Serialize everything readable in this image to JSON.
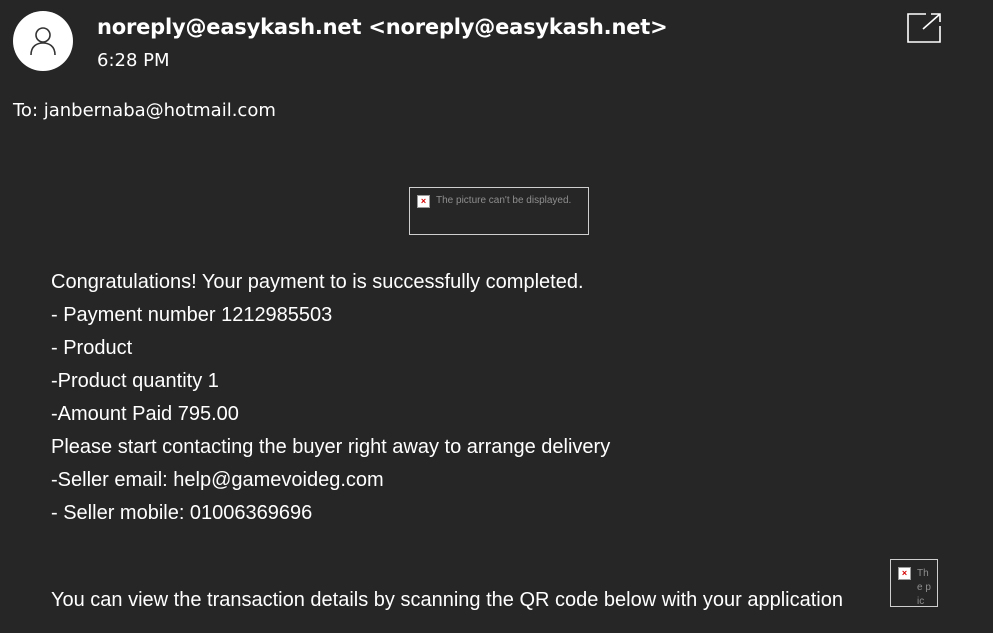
{
  "header": {
    "avatar_icon": "person-icon",
    "sender": "noreply@easykash.net <noreply@easykash.net>",
    "time": "6:28 PM",
    "popout_icon": "open-in-new-window-icon",
    "to": "To: janbernaba@hotmail.com"
  },
  "image_placeholder": {
    "alt": "The picture can't be displayed.",
    "icon": "broken-image-icon"
  },
  "message": {
    "lines": [
      "Congratulations! Your payment to is successfully completed.",
      "- Payment number 1212985503",
      "- Product",
      "-Product quantity 1",
      "-Amount Paid 795.00",
      "Please start contacting the buyer right away to arrange delivery",
      "-Seller email: help@gamevoideg.com",
      "- Seller mobile: 01006369696"
    ],
    "qr_text": "You can view the transaction details by scanning the QR code below with your application"
  },
  "qr_image_placeholder": {
    "alt": "The pic",
    "icon": "broken-image-icon"
  }
}
